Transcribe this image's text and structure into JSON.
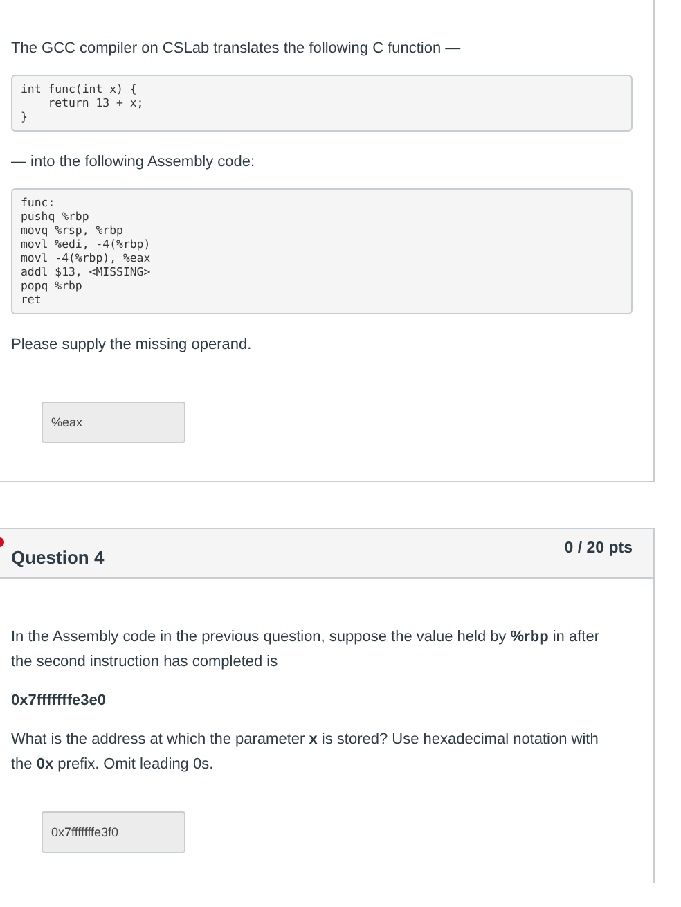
{
  "questions": [
    {
      "blocks": [
        {
          "kind": "paragraph",
          "text": "The GCC compiler on CSLab translates the following C function —"
        },
        {
          "kind": "code",
          "text": "int func(int x) {\n    return 13 + x;\n}"
        },
        {
          "kind": "paragraph",
          "text": "— into the following Assembly code:"
        },
        {
          "kind": "code",
          "text": "func:\npushq %rbp\nmovq %rsp, %rbp\nmovl %edi, -4(%rbp)\nmovl -4(%rbp), %eax\naddl $13, <MISSING>\npopq %rbp\nret"
        },
        {
          "kind": "paragraph",
          "text": "Please supply the missing operand."
        }
      ],
      "answer": "%eax"
    },
    {
      "header": {
        "title": "Question 4",
        "points": "0 / 20 pts",
        "incorrect": true
      },
      "blocks": [
        {
          "kind": "paragraph",
          "text": "In the Assembly code in the previous question, suppose the value held by **%rbp** in after the second instruction has completed is"
        },
        {
          "kind": "value",
          "text": "0x7fffffffe3e0"
        },
        {
          "kind": "paragraph",
          "text": "What is the address at which the parameter **x** is stored? Use hexadecimal notation with the **0x** prefix.  Omit leading 0s."
        }
      ],
      "answer": "0x7fffffffe3f0"
    }
  ]
}
